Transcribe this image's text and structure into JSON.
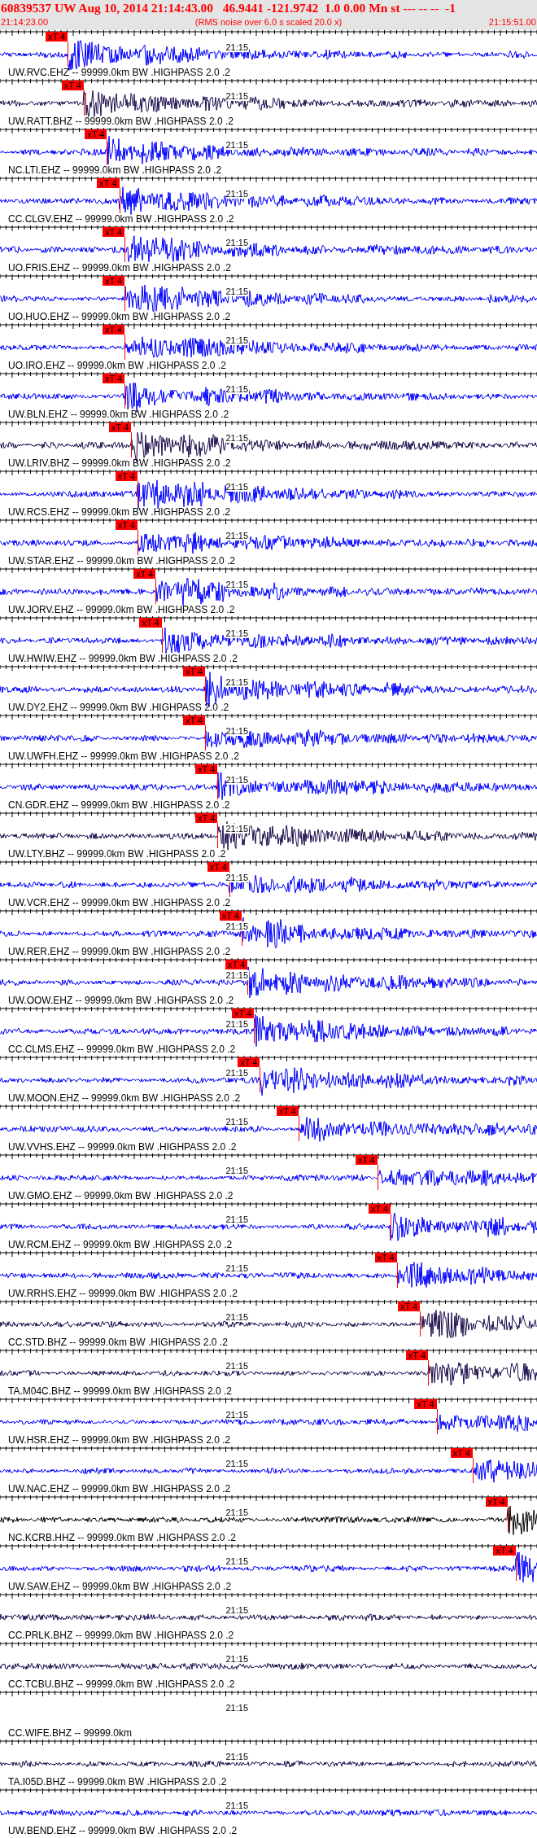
{
  "header": {
    "title": "60839537 UW Aug 10, 2014 21:14:43.00   46.9441 -121.9742  1.0 0.00 Mn st --- -- --  -1",
    "start_time": "21:14:23.00",
    "note": "(RMS noise over 6.0 s scaled 20.0 x)",
    "end_time": "21:15:51.00"
  },
  "traces": [
    {
      "label": "UW.RVC.EHZ -- 99999.0km BW .HIGHPASS 2.0 .2",
      "tick_label": "21:15",
      "color": "#0000ff",
      "pick": {
        "label": "xT 4"
      }
    },
    {
      "label": "UW.RATT.BHZ -- 99999.0km BW .HIGHPASS 2.0 .2",
      "tick_label": "21:15",
      "color": "#1c0c4c",
      "pick": {
        "label": "xT 4"
      }
    },
    {
      "label": "NC.LTI.EHZ -- 99999.0km BW .HIGHPASS 2.0 .2",
      "tick_label": "21:15",
      "color": "#0000ff",
      "pick": {
        "label": "xT 4"
      }
    },
    {
      "label": "CC.CLGV.EHZ -- 99999.0km BW .HIGHPASS 2.0 .2",
      "tick_label": "21:15",
      "color": "#0000ff",
      "pick": {
        "label": "xT 4"
      }
    },
    {
      "label": "UO.FRIS.EHZ -- 99999.0km BW .HIGHPASS 2.0 .2",
      "tick_label": "21:15",
      "color": "#0000ff",
      "pick": {
        "label": "xT 4"
      }
    },
    {
      "label": "UO.HUO.EHZ -- 99999.0km BW .HIGHPASS 2.0 .2",
      "tick_label": "21:15",
      "color": "#0000ff",
      "pick": {
        "label": "xT 4"
      }
    },
    {
      "label": "UO.IRO.EHZ -- 99999.0km BW .HIGHPASS 2.0 .2",
      "tick_label": "21:15",
      "color": "#0000ff",
      "pick": {
        "label": "xT 4"
      }
    },
    {
      "label": "UW.BLN.EHZ -- 99999.0km BW .HIGHPASS 2.0 .2",
      "tick_label": "21:15",
      "color": "#0000ff",
      "pick": {
        "label": "xT 4"
      }
    },
    {
      "label": "UW.LRIV.BHZ -- 99999.0km BW .HIGHPASS 2.0 .2",
      "tick_label": "21:15",
      "color": "#1c0c4c",
      "pick": {
        "label": "xT 4"
      }
    },
    {
      "label": "UW.RCS.EHZ -- 99999.0km BW .HIGHPASS 2.0 .2",
      "tick_label": "21:15",
      "color": "#0000ff",
      "pick": {
        "label": "xT 4"
      }
    },
    {
      "label": "UW.STAR.EHZ -- 99999.0km BW .HIGHPASS 2.0 .2",
      "tick_label": "21:15",
      "color": "#0000ff",
      "pick": {
        "label": "xT 4"
      }
    },
    {
      "label": "UW.JORV.EHZ -- 99999.0km BW .HIGHPASS 2.0 .2",
      "tick_label": "21:15",
      "color": "#0000ff",
      "pick": {
        "label": "xT 4"
      }
    },
    {
      "label": "UW.HWIW.EHZ -- 99999.0km BW .HIGHPASS 2.0 .2",
      "tick_label": "21:15",
      "color": "#0000ff",
      "pick": {
        "label": "xT 4"
      }
    },
    {
      "label": "UW.DY2.EHZ -- 99999.0km BW .HIGHPASS 2.0 .2",
      "tick_label": "21:15",
      "color": "#0000ff",
      "pick": {
        "label": "xT 4"
      }
    },
    {
      "label": "UW.UWFH.EHZ -- 99999.0km BW .HIGHPASS 2.0 .2",
      "tick_label": "21:15",
      "color": "#0000ff",
      "pick": {
        "label": "xT 4"
      }
    },
    {
      "label": "CN.GDR.EHZ -- 99999.0km BW .HIGHPASS 2.0 .2",
      "tick_label": "21:15",
      "color": "#0000ff",
      "pick": {
        "label": "xT 4"
      }
    },
    {
      "label": "UW.LTY.BHZ -- 99999.0km BW .HIGHPASS 2.0 .2",
      "tick_label": "21:15",
      "color": "#1c0c4c",
      "pick": {
        "label": "xT 4"
      }
    },
    {
      "label": "UW.VCR.EHZ -- 99999.0km BW .HIGHPASS 2.0 .2",
      "tick_label": "21:15",
      "color": "#0000ff",
      "pick": {
        "label": "xT 4"
      }
    },
    {
      "label": "UW.RER.EHZ -- 99999.0km BW .HIGHPASS 2.0 .2",
      "tick_label": "21:15",
      "color": "#0000ff",
      "pick": {
        "label": "xT 4"
      }
    },
    {
      "label": "UW.OOW.EHZ -- 99999.0km BW .HIGHPASS 2.0 .2",
      "tick_label": "21:15",
      "color": "#0000ff",
      "pick": {
        "label": "xT 4"
      }
    },
    {
      "label": "CC.CLMS.EHZ -- 99999.0km BW .HIGHPASS 2.0 .2",
      "tick_label": "21:15",
      "color": "#0000ff",
      "pick": {
        "label": "xT 4"
      }
    },
    {
      "label": "UW.MOON.EHZ -- 99999.0km BW .HIGHPASS 2.0 .2",
      "tick_label": "21:15",
      "color": "#0000ff",
      "pick": {
        "label": "xT 4"
      }
    },
    {
      "label": "UW.VVHS.EHZ -- 99999.0km BW .HIGHPASS 2.0 .2",
      "tick_label": "21:15",
      "color": "#0000ff",
      "pick": {
        "label": "xT 4"
      }
    },
    {
      "label": "UW.GMO.EHZ -- 99999.0km BW .HIGHPASS 2.0 .2",
      "tick_label": "21:15",
      "color": "#0000ff",
      "pick": {
        "label": "xT 4"
      }
    },
    {
      "label": "UW.RCM.EHZ -- 99999.0km BW .HIGHPASS 2.0 .2",
      "tick_label": "21:15",
      "color": "#0000ff",
      "pick": {
        "label": "xT 4"
      }
    },
    {
      "label": "UW.RRHS.EHZ -- 99999.0km BW .HIGHPASS 2.0 .2",
      "tick_label": "21:15",
      "color": "#0000ff",
      "pick": {
        "label": "xT 4"
      }
    },
    {
      "label": "CC.STD.BHZ -- 99999.0km BW .HIGHPASS 2.0 .2",
      "tick_label": "21:15",
      "color": "#1c0c4c",
      "pick": {
        "label": "xT 4"
      }
    },
    {
      "label": "TA.M04C.BHZ -- 99999.0km BW .HIGHPASS 2.0 .2",
      "tick_label": "21:15",
      "color": "#1c0c4c",
      "pick": {
        "label": "xT 4"
      }
    },
    {
      "label": "UW.HSR.EHZ -- 99999.0km BW .HIGHPASS 2.0 .2",
      "tick_label": "21:15",
      "color": "#0000ff",
      "pick": {
        "label": "xT 4"
      }
    },
    {
      "label": "UW.NAC.EHZ -- 99999.0km BW .HIGHPASS 2.0 .2",
      "tick_label": "21:15",
      "color": "#0000ff",
      "pick": {
        "label": "xT 4"
      }
    },
    {
      "label": "NC.KCRB.HHZ -- 99999.0km BW .HIGHPASS 2.0 .2",
      "tick_label": "21:15",
      "color": "#000000",
      "pick": {
        "label": "xT 4"
      }
    },
    {
      "label": "UW.SAW.EHZ -- 99999.0km BW .HIGHPASS 2.0 .2",
      "tick_label": "21:15",
      "color": "#0000ff",
      "pick": {
        "label": "xT 4"
      }
    },
    {
      "label": "CC.PRLK.BHZ -- 99999.0km BW .HIGHPASS 2.0 .2",
      "tick_label": "21:15",
      "color": "#1c0c4c"
    },
    {
      "label": "CC.TCBU.BHZ -- 99999.0km BW .HIGHPASS 2.0 .2",
      "tick_label": "21:15",
      "color": "#1c0c4c"
    },
    {
      "label": "CC.WIFE.BHZ -- 99999.0km",
      "tick_label": "21:15"
    },
    {
      "label": "TA.I05D.BHZ -- 99999.0km BW .HIGHPASS 2.0 .2",
      "tick_label": "21:15",
      "color": "#1c0c4c"
    },
    {
      "label": "UW.BEND.EHZ -- 99999.0km BW .HIGHPASS 2.0 .2",
      "tick_label": "21:15",
      "color": "#0000ff"
    }
  ]
}
